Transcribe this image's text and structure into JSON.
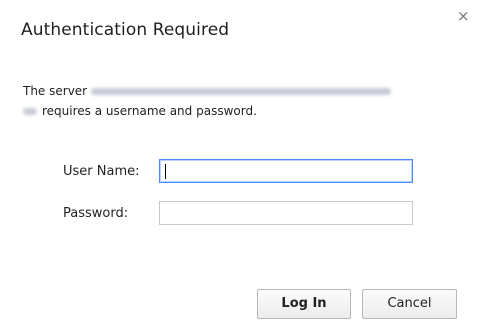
{
  "dialog": {
    "title": "Authentication Required",
    "close_glyph": "×",
    "message_prefix": "The server",
    "message_suffix": "requires a username and password.",
    "username_label": "User Name:",
    "password_label": "Password:",
    "username_value": "",
    "password_value": "",
    "login_label": "Log In",
    "cancel_label": "Cancel"
  },
  "colors": {
    "focus_border": "#4b8df8",
    "field_border": "#c9c9c9",
    "button_border": "#b8b8b8"
  }
}
